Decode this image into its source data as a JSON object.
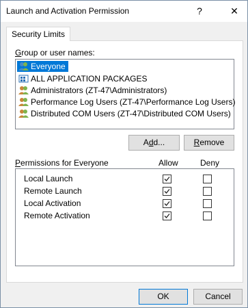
{
  "window": {
    "title": "Launch and Activation Permission",
    "help_glyph": "?",
    "close_glyph": "✕"
  },
  "tabs": [
    {
      "label": "Security Limits"
    }
  ],
  "groups": {
    "label_prefix": "G",
    "label_rest": "roup or user names:",
    "items": [
      {
        "label": "Everyone",
        "icon": "users-group-icon"
      },
      {
        "label": "ALL APPLICATION PACKAGES",
        "icon": "packages-icon"
      },
      {
        "label": "Administrators (ZT-47\\Administrators)",
        "icon": "users-group-icon"
      },
      {
        "label": "Performance Log Users (ZT-47\\Performance Log Users)",
        "icon": "users-group-icon"
      },
      {
        "label": "Distributed COM Users (ZT-47\\Distributed COM Users)",
        "icon": "users-group-icon"
      }
    ]
  },
  "buttons": {
    "add": {
      "prefix": "A",
      "accel": "d",
      "suffix": "d..."
    },
    "remove": {
      "accel": "R",
      "suffix": "emove"
    }
  },
  "permissions": {
    "header_prefix": "P",
    "header_rest": "ermissions for Everyone",
    "allow_label": "Allow",
    "deny_label": "Deny",
    "rows": [
      {
        "name": "Local Launch",
        "allow": true,
        "deny": false
      },
      {
        "name": "Remote Launch",
        "allow": true,
        "deny": false
      },
      {
        "name": "Local Activation",
        "allow": true,
        "deny": false
      },
      {
        "name": "Remote Activation",
        "allow": true,
        "deny": false
      }
    ]
  },
  "footer": {
    "ok": "OK",
    "cancel": "Cancel"
  },
  "colors": {
    "selection": "#0078d7",
    "accent_border": "#0078d7"
  }
}
